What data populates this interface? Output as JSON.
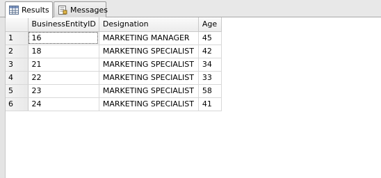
{
  "tabs": [
    {
      "label": "Results",
      "icon": "grid-icon",
      "active": true
    },
    {
      "label": "Messages",
      "icon": "messages-icon",
      "active": false
    }
  ],
  "grid": {
    "columns": [
      "BusinessEntityID",
      "Designation",
      "Age"
    ],
    "rows": [
      {
        "num": "1",
        "id": "16",
        "designation": "MARKETING MANAGER",
        "age": "45"
      },
      {
        "num": "2",
        "id": "18",
        "designation": "MARKETING SPECIALIST",
        "age": "42"
      },
      {
        "num": "3",
        "id": "21",
        "designation": "MARKETING SPECIALIST",
        "age": "34"
      },
      {
        "num": "4",
        "id": "22",
        "designation": "MARKETING SPECIALIST",
        "age": "33"
      },
      {
        "num": "5",
        "id": "23",
        "designation": "MARKETING SPECIALIST",
        "age": "58"
      },
      {
        "num": "6",
        "id": "24",
        "designation": "MARKETING SPECIALIST",
        "age": "41"
      }
    ]
  },
  "colors": {
    "tabstrip": "#e8e8e8",
    "gridline": "#d8d8d8",
    "header": "#ececec"
  }
}
